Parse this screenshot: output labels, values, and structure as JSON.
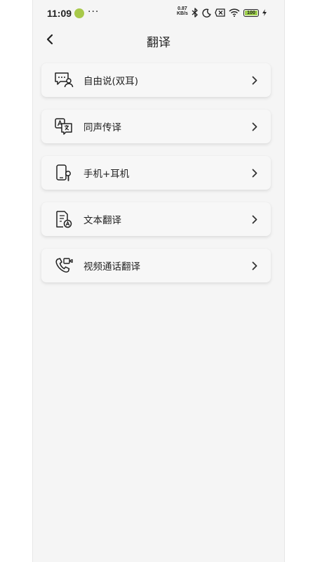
{
  "status_bar": {
    "time": "11:09",
    "more": "···",
    "speed_value": "0.87",
    "speed_unit": "KB/s",
    "battery": "100"
  },
  "header": {
    "title": "翻译"
  },
  "menu": {
    "items": [
      {
        "label": "自由说(双耳)",
        "icon": "chat-bubble-person-icon"
      },
      {
        "label": "同声传译",
        "icon": "translate-icon"
      },
      {
        "label": "手机+耳机",
        "icon": "phone-earbud-icon"
      },
      {
        "label": "文本翻译",
        "icon": "document-translate-icon"
      },
      {
        "label": "视频通话翻译",
        "icon": "video-call-icon"
      }
    ]
  },
  "colors": {
    "background": "#f5f5f5",
    "card": "#f7f7f7",
    "text": "#222222",
    "battery_fill": "#9ed04c"
  }
}
